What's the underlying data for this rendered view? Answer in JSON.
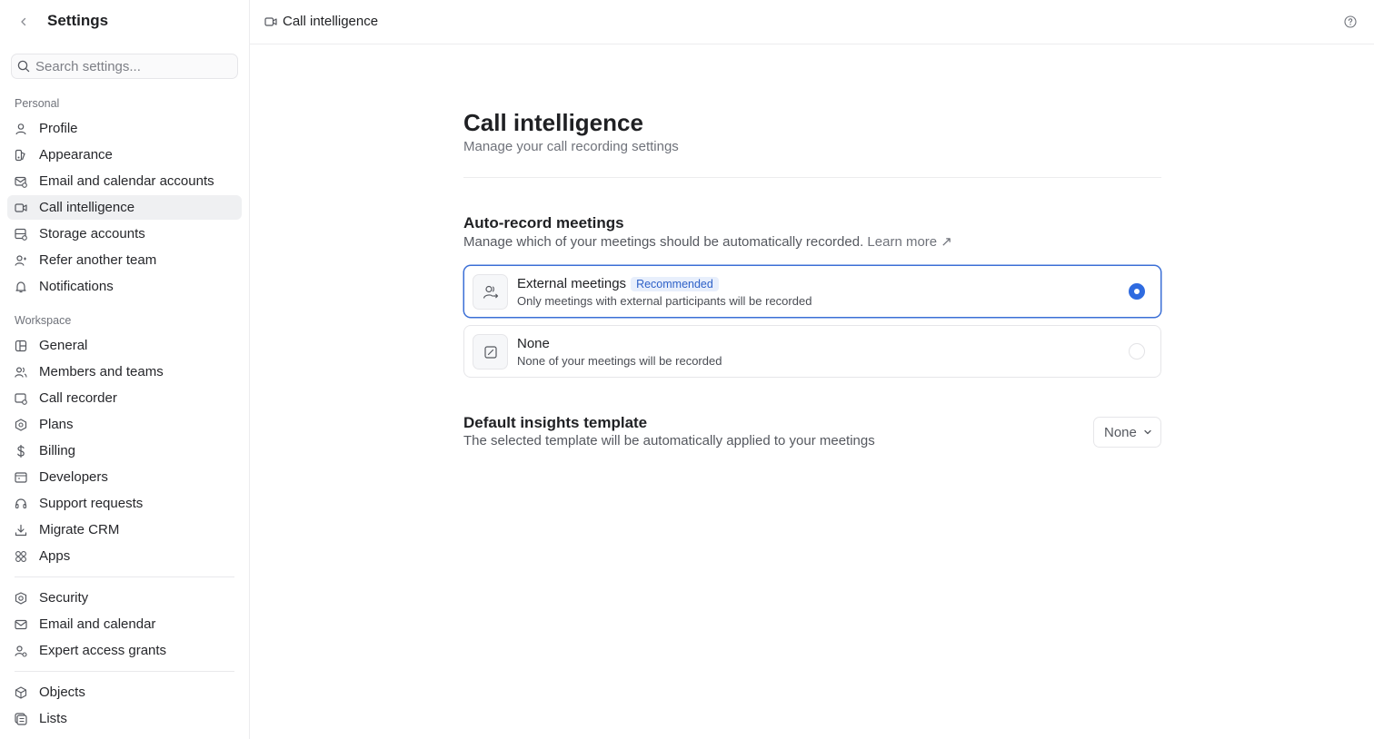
{
  "sidebar": {
    "title": "Settings",
    "search_placeholder": "Search settings...",
    "sections": {
      "personal": "Personal",
      "workspace": "Workspace"
    },
    "personal_items": [
      {
        "label": "Profile",
        "icon": "person-icon"
      },
      {
        "label": "Appearance",
        "icon": "palette-icon"
      },
      {
        "label": "Email and calendar accounts",
        "icon": "mail-account-icon"
      },
      {
        "label": "Call intelligence",
        "icon": "video-icon",
        "active": true
      },
      {
        "label": "Storage accounts",
        "icon": "storage-icon"
      },
      {
        "label": "Refer another team",
        "icon": "refer-icon"
      },
      {
        "label": "Notifications",
        "icon": "bell-icon"
      }
    ],
    "workspace_items": [
      {
        "label": "General",
        "icon": "layout-icon"
      },
      {
        "label": "Members and teams",
        "icon": "users-icon"
      },
      {
        "label": "Call recorder",
        "icon": "recorder-icon"
      },
      {
        "label": "Plans",
        "icon": "plans-icon"
      },
      {
        "label": "Billing",
        "icon": "dollar-icon"
      },
      {
        "label": "Developers",
        "icon": "code-icon"
      },
      {
        "label": "Support requests",
        "icon": "headset-icon"
      },
      {
        "label": "Migrate CRM",
        "icon": "download-icon"
      },
      {
        "label": "Apps",
        "icon": "grid-icon"
      }
    ],
    "security_items": [
      {
        "label": "Security",
        "icon": "shield-icon"
      },
      {
        "label": "Email and calendar",
        "icon": "envelope-icon"
      },
      {
        "label": "Expert access grants",
        "icon": "user-key-icon"
      }
    ],
    "object_items": [
      {
        "label": "Objects",
        "icon": "cube-icon"
      },
      {
        "label": "Lists",
        "icon": "list-icon"
      }
    ]
  },
  "topbar": {
    "breadcrumb": "Call intelligence",
    "help_icon": "help-circle-icon"
  },
  "main": {
    "title": "Call intelligence",
    "subtitle": "Manage your call recording settings",
    "auto_record": {
      "title": "Auto-record meetings",
      "description": "Manage which of your meetings should be automatically recorded.",
      "learn_more": "Learn more ↗",
      "options": [
        {
          "title": "External meetings",
          "badge": "Recommended",
          "description": "Only meetings with external participants will be recorded",
          "selected": true,
          "icon": "external-users-icon"
        },
        {
          "title": "None",
          "badge": "",
          "description": "None of your meetings will be recorded",
          "selected": false,
          "icon": "none-slash-icon"
        }
      ]
    },
    "insights": {
      "title": "Default insights template",
      "description": "The selected template will be automatically applied to your meetings",
      "selected_value": "None"
    }
  },
  "colors": {
    "accent": "#2f6be0",
    "badge_bg": "#e8effc",
    "active_nav_bg": "#eff0f2"
  }
}
